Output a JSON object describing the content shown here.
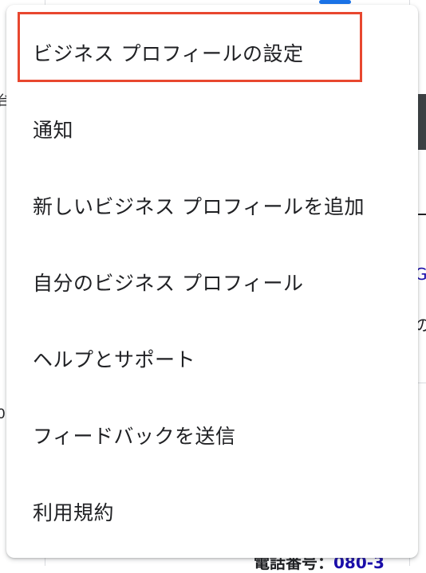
{
  "menu": {
    "items": [
      {
        "label": "ビジネス プロフィールの設定",
        "name": "menu-item-business-profile-settings",
        "highlighted": true
      },
      {
        "label": "通知",
        "name": "menu-item-notifications"
      },
      {
        "label": "新しいビジネス プロフィールを追加",
        "name": "menu-item-add-new-business-profile"
      },
      {
        "label": "自分のビジネス プロフィール",
        "name": "menu-item-my-business-profiles"
      },
      {
        "label": "ヘルプとサポート",
        "name": "menu-item-help-and-support"
      },
      {
        "label": "フィードバックを送信",
        "name": "menu-item-send-feedback"
      },
      {
        "label": "利用規約",
        "name": "menu-item-terms-of-service"
      }
    ],
    "highlight_color": "#e8472f"
  },
  "background": {
    "right_link_fragment": "G",
    "right_text_fragment": "の",
    "left_text_fragment_1": "台",
    "left_text_fragment_2": "0",
    "bottom_text": "電話番号：",
    "bottom_link": "080-3"
  }
}
